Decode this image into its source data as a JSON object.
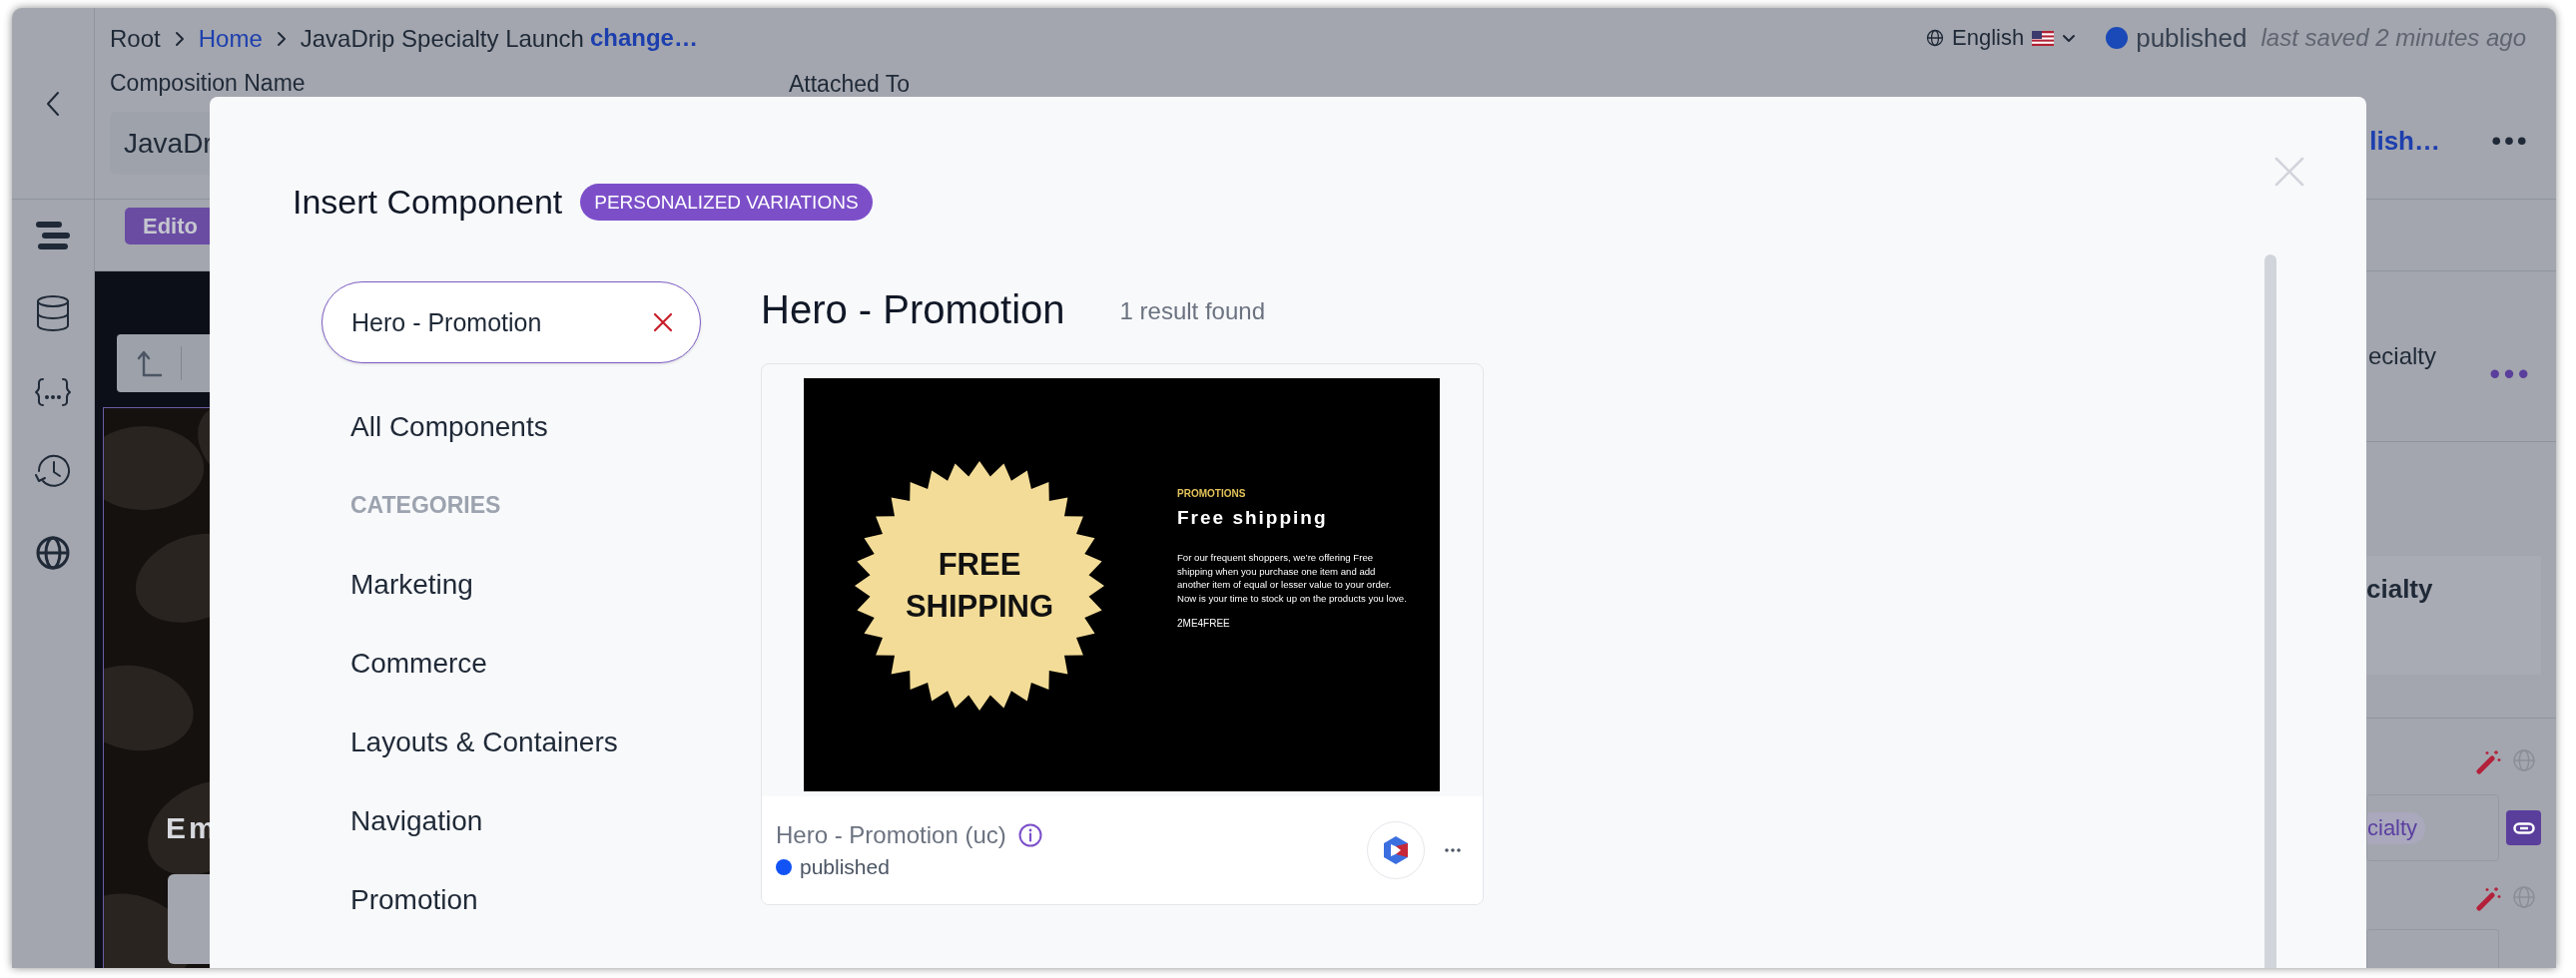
{
  "header": {
    "breadcrumb": [
      {
        "label": "Root",
        "link": false
      },
      {
        "label": "Home",
        "link": true
      },
      {
        "label": "JavaDrip Specialty Launch",
        "link": false
      }
    ],
    "change_link": "change…",
    "composition_name": {
      "label": "Composition Name",
      "value": "JavaDr"
    },
    "attached_to": {
      "label": "Attached To"
    },
    "language": "English",
    "status": "published",
    "last_saved": "last saved 2 minutes ago",
    "publish_button": "lish…"
  },
  "toolbar": {
    "editor_button": "Edito"
  },
  "canvas": {
    "hero_heading": "Em"
  },
  "right_panel": {
    "title": "ecialty",
    "card_title": "cialty",
    "tag": "cialty"
  },
  "modal": {
    "title": "Insert Component",
    "badge": "PERSONALIZED VARIATIONS",
    "search": {
      "value": "Hero - Promotion"
    },
    "nav": [
      {
        "label": "All Components",
        "kind": "item"
      },
      {
        "label": "CATEGORIES",
        "kind": "heading"
      },
      {
        "label": "Marketing",
        "kind": "item"
      },
      {
        "label": "Commerce",
        "kind": "item"
      },
      {
        "label": "Layouts & Containers",
        "kind": "item"
      },
      {
        "label": "Navigation",
        "kind": "item"
      },
      {
        "label": "Promotion",
        "kind": "item"
      }
    ],
    "results_title": "Hero - Promotion",
    "results_count": "1 result found",
    "results": [
      {
        "name": "Hero - Promotion (uc)",
        "status": "published",
        "preview": {
          "burst_lines": [
            "FREE",
            "SHIPPING"
          ],
          "eyebrow": "PROMOTIONS",
          "heading": "Free shipping",
          "body": "For our frequent shoppers, we’re offering Free shipping when you purchase one item and add another item of equal or lesser value to your order. Now is your time to stock up on the products you love.",
          "code": "2ME4FREE"
        }
      }
    ]
  }
}
